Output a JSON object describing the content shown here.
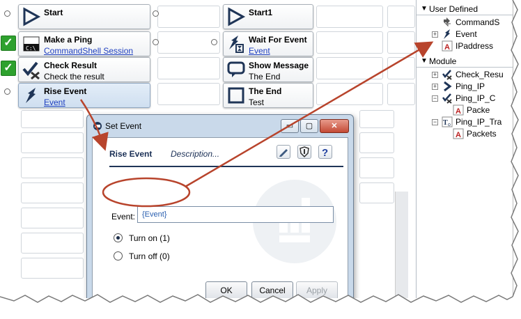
{
  "workflow": {
    "left_column": [
      {
        "title": "Start",
        "subtitle": "",
        "icon": "start-flag-icon",
        "status": "none"
      },
      {
        "title": "Make a Ping",
        "subtitle": "CommandShell Session",
        "subtitle_link": true,
        "icon": "command-shell-icon",
        "status": "passed"
      },
      {
        "title": "Check Result",
        "subtitle": "Check the result",
        "subtitle_link": false,
        "icon": "check-tools-icon",
        "status": "passed"
      },
      {
        "title": "Rise Event",
        "subtitle": "Event",
        "subtitle_link": true,
        "icon": "rise-event-icon",
        "status": "none",
        "selected": true
      }
    ],
    "right_column": [
      {
        "title": "Start1",
        "subtitle": "",
        "icon": "start-flag-icon"
      },
      {
        "title": "Wait For Event",
        "subtitle": "Event",
        "subtitle_link": true,
        "icon": "wait-event-icon"
      },
      {
        "title": "Show Message",
        "subtitle": "The End",
        "subtitle_link": false,
        "icon": "message-icon"
      },
      {
        "title": "The End",
        "subtitle": "Test",
        "subtitle_link": false,
        "icon": "end-icon"
      }
    ]
  },
  "panel": {
    "user_defined_label": "User Defined",
    "user_defined_items": [
      {
        "label": "CommandS",
        "icon": "command-shell-icon",
        "expandable": false
      },
      {
        "label": "Event",
        "icon": "event-icon",
        "expandable": true
      },
      {
        "label": "IPaddress",
        "icon": "text-variable-icon",
        "expandable": false
      }
    ],
    "module_label": "Module",
    "module_items": [
      {
        "label": "Check_Resu",
        "icon": "check-tools-icon",
        "expandable": true,
        "expanded": false,
        "indent": 0
      },
      {
        "label": "Ping_IP",
        "icon": "arrow-right-icon",
        "expandable": true,
        "expanded": false,
        "indent": 0
      },
      {
        "label": "Ping_IP_C",
        "icon": "check-tools-icon",
        "expandable": true,
        "expanded": true,
        "indent": 0
      },
      {
        "label": "Packe",
        "icon": "text-variable-icon",
        "expandable": false,
        "indent": 1
      },
      {
        "label": "Ping_IP_Tra",
        "icon": "template-icon",
        "expandable": true,
        "expanded": true,
        "indent": 0
      },
      {
        "label": "Packets",
        "icon": "text-variable-icon",
        "expandable": false,
        "indent": 1
      }
    ]
  },
  "dialog": {
    "title": "Set Event",
    "tab_active": "Rise Event",
    "tab_other": "Description...",
    "event_label": "Event:",
    "event_value": "{Event}",
    "radio_on_label": "Turn on (1)",
    "radio_off_label": "Turn off (0)",
    "radio_selected": "on",
    "ok_label": "OK",
    "cancel_label": "Cancel",
    "apply_label": "Apply"
  },
  "colors": {
    "annotation": "#b8442c",
    "selected_activity": "#d6e5f5",
    "passed": "#2ea12e",
    "link": "#1f3fbf"
  }
}
